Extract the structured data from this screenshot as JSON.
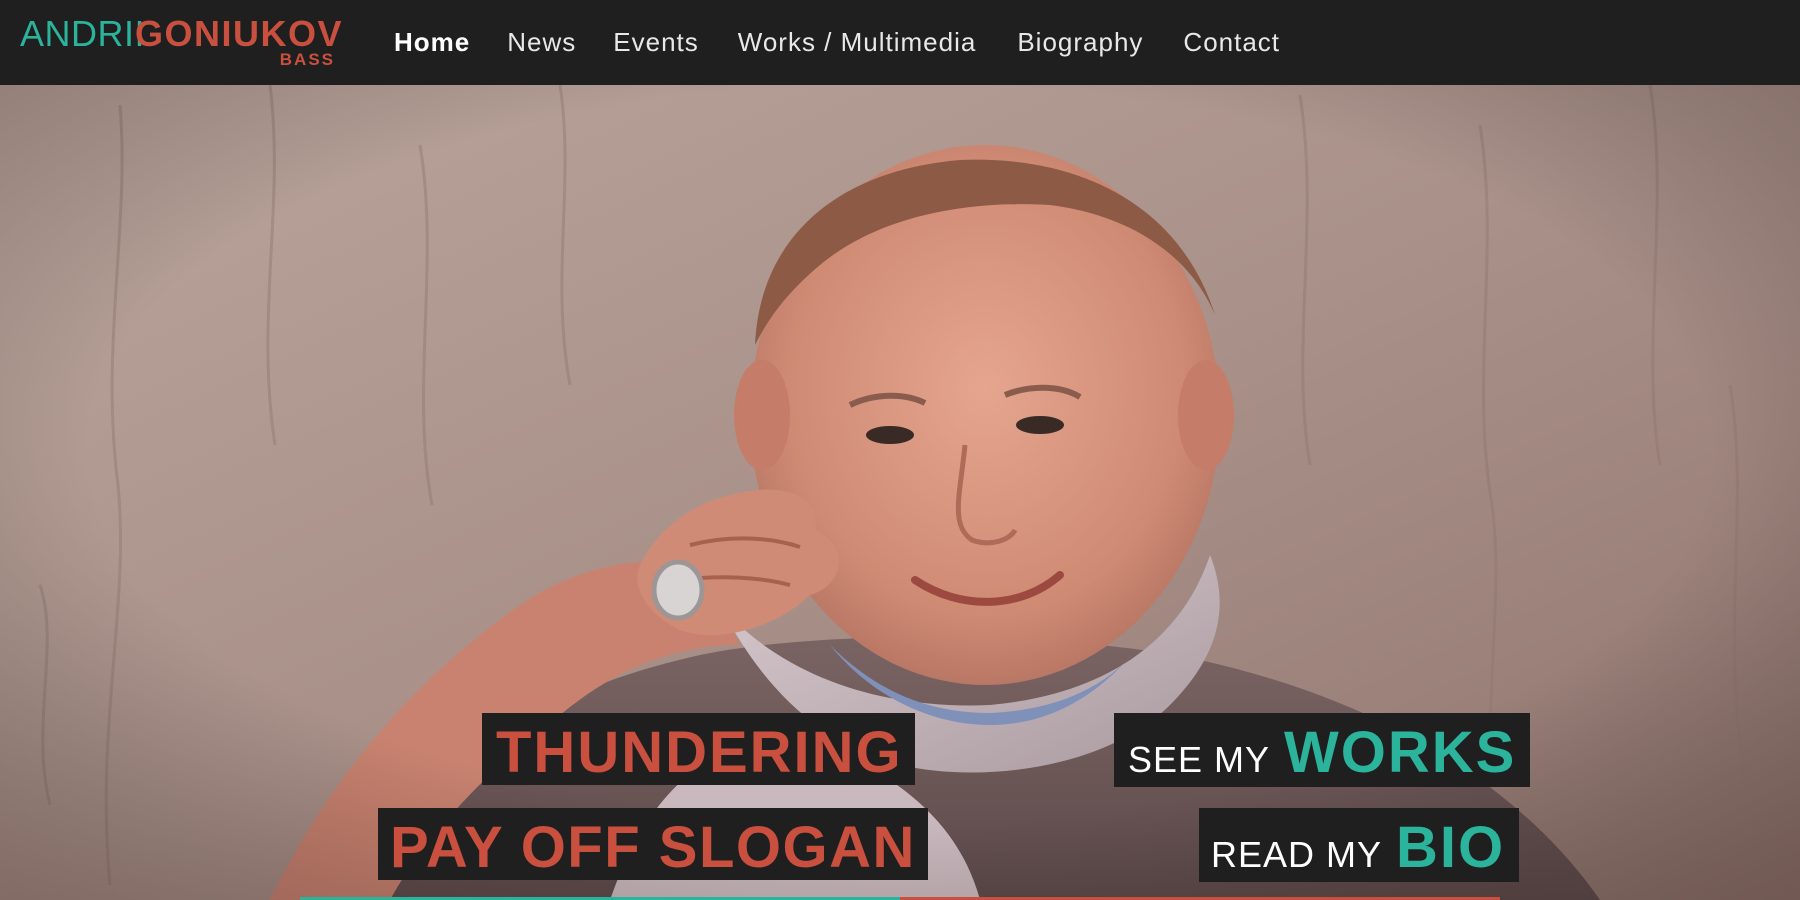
{
  "logo": {
    "first": "ANDRII",
    "last": "GONIUKOV",
    "sub": "BASS"
  },
  "nav": {
    "items": [
      {
        "label": "Home",
        "active": true
      },
      {
        "label": "News",
        "active": false
      },
      {
        "label": "Events",
        "active": false
      },
      {
        "label": "Works / Multimedia",
        "active": false
      },
      {
        "label": "Biography",
        "active": false
      },
      {
        "label": "Contact",
        "active": false
      }
    ]
  },
  "hero": {
    "slogan_line1": "THUNDERING",
    "slogan_line2": "PAY OFF SLOGAN",
    "cta_works": {
      "prefix": "SEE MY",
      "highlight": "WORKS"
    },
    "cta_bio": {
      "prefix": "READ MY",
      "highlight": "BIO"
    },
    "photo_icon": "portrait-photo"
  },
  "colors": {
    "teal": "#2bb39c",
    "coral": "#c9503f",
    "bar": "#1f1f1f",
    "wall": "#b09a92"
  }
}
